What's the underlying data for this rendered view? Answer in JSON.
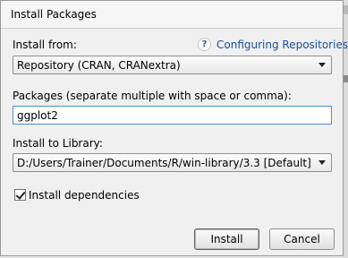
{
  "dialog": {
    "title": "Install Packages"
  },
  "install_from": {
    "label": "Install from:",
    "value": "Repository (CRAN, CRANextra)",
    "help_glyph": "?",
    "help_link": "Configuring Repositories"
  },
  "packages": {
    "label": "Packages (separate multiple with space or comma):",
    "value": "ggplot2"
  },
  "library": {
    "label": "Install to Library:",
    "value": "D:/Users/Trainer/Documents/R/win-library/3.3 [Default]"
  },
  "dependencies": {
    "label": "Install dependencies",
    "checked": true
  },
  "buttons": {
    "install": "Install",
    "cancel": "Cancel"
  }
}
